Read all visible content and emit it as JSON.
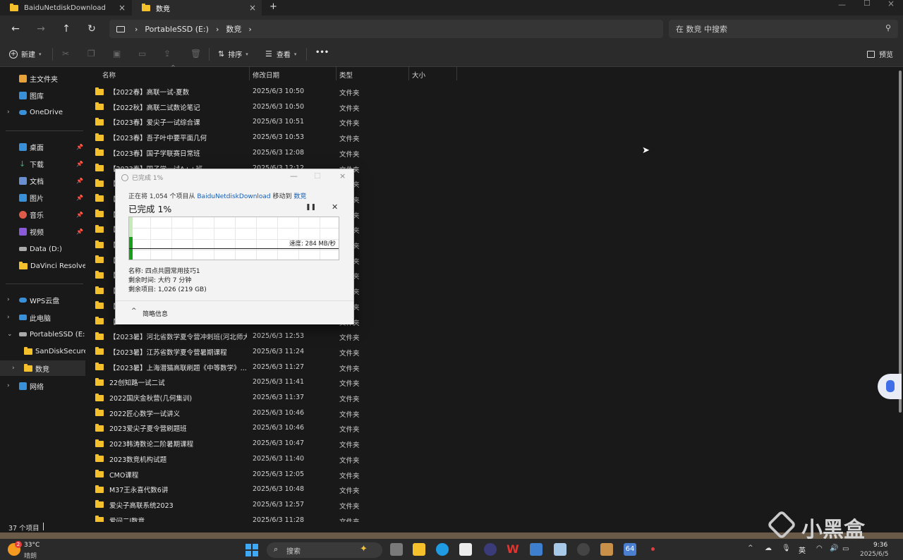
{
  "tabs": [
    {
      "label": "BaiduNetdiskDownload",
      "active": false
    },
    {
      "label": "数竞",
      "active": true
    }
  ],
  "new_tab_label": "+",
  "address": {
    "parts": [
      "PortableSSD (E:)",
      "数竞"
    ]
  },
  "search": {
    "placeholder": "在 数竞 中搜索"
  },
  "toolbar": {
    "new_label": "新建",
    "sort_label": "排序",
    "view_label": "查看",
    "more_label": "•••",
    "preview_label": "预览"
  },
  "sidebar": {
    "items": [
      {
        "label": "主文件夹",
        "color": "#e8a23a"
      },
      {
        "label": "图库",
        "color": "#3a8fd9"
      },
      {
        "label": "OneDrive",
        "color": "#3a8fd9"
      },
      {
        "label": "桌面",
        "color": "#3a8fd9"
      },
      {
        "label": "下载",
        "color": "#35b26a"
      },
      {
        "label": "文档",
        "color": "#6a8fd0"
      },
      {
        "label": "图片",
        "color": "#3a8fd9"
      },
      {
        "label": "音乐",
        "color": "#e05a4a"
      },
      {
        "label": "视频",
        "color": "#8a5ad9"
      },
      {
        "label": "Data (D:)",
        "color": "#aaaaaa"
      },
      {
        "label": "DaVinci Resolve St",
        "color": "#f4c02c"
      },
      {
        "label": "WPS云盘",
        "color": "#3a8fd9"
      },
      {
        "label": "此电脑",
        "color": "#3a8fd9"
      },
      {
        "label": "PortableSSD (E:)",
        "color": "#aaaaaa"
      },
      {
        "label": "SanDiskSecureAc",
        "color": "#f4c02c"
      },
      {
        "label": "数竞",
        "color": "#f4c02c"
      },
      {
        "label": "网络",
        "color": "#3a8fd9"
      }
    ]
  },
  "columns": {
    "name": "名称",
    "date": "修改日期",
    "type": "类型",
    "size": "大小"
  },
  "files": [
    {
      "name": "【2022春】高联一试-夏数",
      "date": "2025/6/3 10:50",
      "type": "文件夹"
    },
    {
      "name": "【2022秋】高联二试数论笔记",
      "date": "2025/6/3 10:50",
      "type": "文件夹"
    },
    {
      "name": "【2023春】爱尖子一试综合课",
      "date": "2025/6/3 10:51",
      "type": "文件夹"
    },
    {
      "name": "【2023春】吾子叶中要平面几何",
      "date": "2025/6/3 10:53",
      "type": "文件夹"
    },
    {
      "name": "【2023春】国子学联赛日常班",
      "date": "2025/6/3 12:08",
      "type": "文件夹"
    },
    {
      "name": "【2023春】国子学一试A++班",
      "date": "2025/6/3 12:12",
      "type": "文件夹"
    },
    {
      "name": "【2",
      "date": "",
      "type": "文件夹"
    },
    {
      "name": "【2",
      "date": "",
      "type": "文件夹"
    },
    {
      "name": "【2",
      "date": "",
      "type": "文件夹"
    },
    {
      "name": "【2",
      "date": "",
      "type": "文件夹"
    },
    {
      "name": "【2",
      "date": "",
      "type": "文件夹"
    },
    {
      "name": "【2",
      "date": "",
      "type": "文件夹"
    },
    {
      "name": "【2",
      "date": "",
      "type": "文件夹"
    },
    {
      "name": "【2",
      "date": "",
      "type": "文件夹"
    },
    {
      "name": "【2",
      "date": "",
      "type": "文件夹"
    },
    {
      "name": "【2",
      "date": "",
      "type": "文件夹"
    },
    {
      "name": "【2023暑】河北省数学夏令营冲刺班(河北师大...",
      "date": "2025/6/3 12:53",
      "type": "文件夹"
    },
    {
      "name": "【2023暑】江苏省数学夏令营暑期课程",
      "date": "2025/6/3 11:24",
      "type": "文件夹"
    },
    {
      "name": "【2023暑】上海潜猫高联刷题《中等数学》...",
      "date": "2025/6/3 11:27",
      "type": "文件夹"
    },
    {
      "name": "22创知路一试二试",
      "date": "2025/6/3 11:41",
      "type": "文件夹"
    },
    {
      "name": "2022国庆金秋营(几何集训)",
      "date": "2025/6/3 11:37",
      "type": "文件夹"
    },
    {
      "name": "2022匠心数学一试讲义",
      "date": "2025/6/3 10:46",
      "type": "文件夹"
    },
    {
      "name": "2023爱尖子夏令营刷题班",
      "date": "2025/6/3 10:46",
      "type": "文件夹"
    },
    {
      "name": "2023韩涛数论二阶暑期课程",
      "date": "2025/6/3 10:47",
      "type": "文件夹"
    },
    {
      "name": "2023数竞机构试题",
      "date": "2025/6/3 11:40",
      "type": "文件夹"
    },
    {
      "name": "CMO课程",
      "date": "2025/6/3 12:05",
      "type": "文件夹"
    },
    {
      "name": "M37王永喜代数6讲",
      "date": "2025/6/3 10:48",
      "type": "文件夹"
    },
    {
      "name": "爱尖子高联系统2023",
      "date": "2025/6/3 12:57",
      "type": "文件夹"
    },
    {
      "name": "爱问二l数竞",
      "date": "2025/6/3 11:28",
      "type": "文件夹"
    }
  ],
  "status": {
    "count": "37 个项目"
  },
  "dialog": {
    "title": "已完成 1%",
    "info_prefix": "正在将 1,054 个项目从",
    "info_source": "BaiduNetdiskDownload",
    "info_mid": "移动到",
    "info_dest": "数竞",
    "percent": "已完成 1%",
    "progress_fraction": 0.01,
    "speed": "速度: 284 MB/秒",
    "name_line": "名称: 四点共圆常用技巧1",
    "time_line": "剩余时间: 大约 7 分钟",
    "items_line": "剩余项目: 1,026 (219 GB)",
    "less_info": "简略信息"
  },
  "taskbar": {
    "weather_temp": "33°C",
    "weather_desc": "晴朗",
    "weather_badge": "2",
    "search_label": "搜索",
    "tray_lang": "英",
    "time": "9:36",
    "date": "2025/6/5",
    "badge_label": "64"
  },
  "watermark": "小黑盒"
}
